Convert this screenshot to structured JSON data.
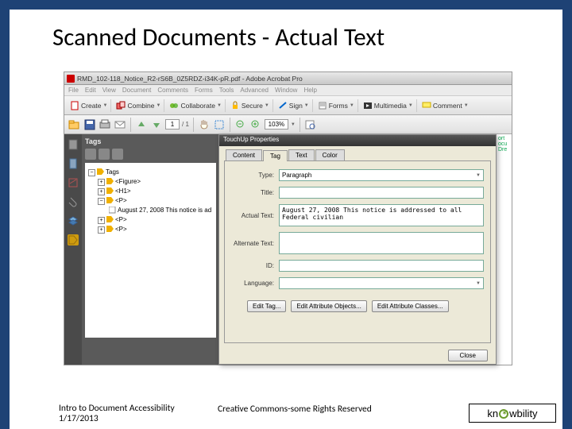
{
  "slide": {
    "title": "Scanned Documents - Actual Text"
  },
  "titlebar": {
    "filename": "RMD_102-118_Notice_R2-rS6B_0Z5RDZ-i34K-pR.pdf - Adobe Acrobat Pro"
  },
  "menubar": {
    "items": [
      "File",
      "Edit",
      "View",
      "Document",
      "Comments",
      "Forms",
      "Tools",
      "Advanced",
      "Window",
      "Help"
    ]
  },
  "toolbar1": {
    "create": "Create",
    "combine": "Combine",
    "collaborate": "Collaborate",
    "secure": "Secure",
    "sign": "Sign",
    "forms": "Forms",
    "multimedia": "Multimedia",
    "comment": "Comment"
  },
  "toolbar2": {
    "page_current": "1",
    "page_total": "/ 1",
    "zoom": "103%"
  },
  "tags_panel": {
    "title": "Tags",
    "root": "Tags",
    "figure": "<Figure>",
    "h1": "<H1>",
    "p": "<P>",
    "text_node": "August 27, 2008 This notice is ad",
    "p2": "<P>",
    "p3": "<P>"
  },
  "dialog": {
    "title": "TouchUp Properties",
    "tabs": {
      "content": "Content",
      "tag": "Tag",
      "text": "Text",
      "color": "Color"
    },
    "fields": {
      "type_label": "Type:",
      "type_value": "Paragraph",
      "title_label": "Title:",
      "title_value": "",
      "actual_label": "Actual Text:",
      "actual_value": "August 27, 2008 This notice is addressed to all Federal civilian",
      "alternate_label": "Alternate Text:",
      "alternate_value": "",
      "id_label": "ID:",
      "id_value": "",
      "language_label": "Language:",
      "language_value": ""
    },
    "buttons": {
      "edit_tag": "Edit Tag...",
      "edit_attr": "Edit Attribute Objects...",
      "edit_class": "Edit Attribute Classes...",
      "close": "Close"
    }
  },
  "footer": {
    "left_line1": "Intro to Document Accessibility",
    "left_line2": "1/17/2013",
    "center": "Creative Commons-some Rights Reserved",
    "brand_pre": "kn",
    "brand_post": "wbility"
  },
  "side_frag": {
    "l1": "ort",
    "l2": "ocu",
    "l3": "Dre"
  }
}
